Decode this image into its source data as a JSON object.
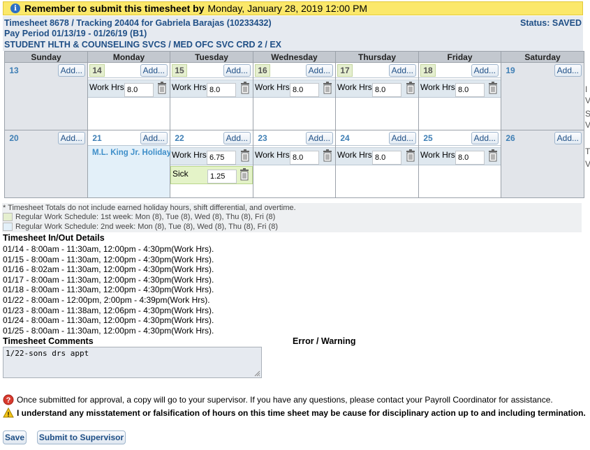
{
  "banner": {
    "bold": "Remember to submit this timesheet by",
    "date": "Monday, January 28, 2019 12:00 PM"
  },
  "header": {
    "line1": "Timesheet 8678 / Tracking 20404 for Gabriela Barajas (10233432)",
    "line2": "Pay Period 01/13/19 - 01/26/19 (B1)",
    "line3": "STUDENT HLTH & COUNSELING SVCS / MED OFC SVC CRD 2 / EX",
    "status": "Status: SAVED"
  },
  "calendar": {
    "days": [
      "Sunday",
      "Monday",
      "Tuesday",
      "Wednesday",
      "Thursday",
      "Friday",
      "Saturday"
    ],
    "add_label": "Add...",
    "week1": [
      {
        "num": "13",
        "type": "weekend",
        "entries": []
      },
      {
        "num": "14",
        "type": "w1",
        "entries": [
          {
            "label": "Work Hrs",
            "value": "8.0"
          }
        ]
      },
      {
        "num": "15",
        "type": "w1",
        "entries": [
          {
            "label": "Work Hrs",
            "value": "8.0"
          }
        ]
      },
      {
        "num": "16",
        "type": "w1",
        "entries": [
          {
            "label": "Work Hrs",
            "value": "8.0"
          }
        ]
      },
      {
        "num": "17",
        "type": "w1",
        "entries": [
          {
            "label": "Work Hrs",
            "value": "8.0"
          }
        ]
      },
      {
        "num": "18",
        "type": "w1",
        "entries": [
          {
            "label": "Work Hrs",
            "value": "8.0"
          }
        ]
      },
      {
        "num": "19",
        "type": "weekend",
        "entries": []
      }
    ],
    "week2": [
      {
        "num": "20",
        "type": "weekend",
        "entries": []
      },
      {
        "num": "21",
        "type": "holiday",
        "holiday": "M.L. King Jr. Holiday",
        "entries": []
      },
      {
        "num": "22",
        "type": "w2",
        "entries": [
          {
            "label": "Work Hrs",
            "value": "6.75"
          },
          {
            "label": "Sick",
            "value": "1.25",
            "kind": "sick"
          }
        ]
      },
      {
        "num": "23",
        "type": "w2",
        "entries": [
          {
            "label": "Work Hrs",
            "value": "8.0"
          }
        ]
      },
      {
        "num": "24",
        "type": "w2",
        "entries": [
          {
            "label": "Work Hrs",
            "value": "8.0"
          }
        ]
      },
      {
        "num": "25",
        "type": "w2",
        "entries": [
          {
            "label": "Work Hrs",
            "value": "8.0"
          }
        ]
      },
      {
        "num": "26",
        "type": "weekend",
        "entries": []
      }
    ]
  },
  "legend": {
    "note": "* Timesheet Totals do not include earned holiday hours, shift differential, and overtime.",
    "week1": "Regular Work Schedule: 1st week: Mon (8), Tue (8), Wed (8), Thu (8), Fri (8)",
    "week2": "Regular Work Schedule: 2nd week: Mon (8), Tue (8), Wed (8), Thu (8), Fri (8)",
    "week1_color": "#e5efcf",
    "week2_color": "#e3f0f9"
  },
  "inout": {
    "title": "Timesheet In/Out Details",
    "lines": [
      "01/14 - 8:00am - 11:30am, 12:00pm - 4:30pm(Work Hrs).",
      "01/15 - 8:00am - 11:30am, 12:00pm - 4:30pm(Work Hrs).",
      "01/16 - 8:02am - 11:30am, 12:00pm - 4:30pm(Work Hrs).",
      "01/17 - 8:00am - 11:30am, 12:00pm - 4:30pm(Work Hrs).",
      "01/18 - 8:00am - 11:30am, 12:00pm - 4:30pm(Work Hrs).",
      "01/22 - 8:00am - 12:00pm, 2:00pm - 4:39pm(Work Hrs).",
      "01/23 - 8:00am - 11:38am, 12:06pm - 4:30pm(Work Hrs).",
      "01/24 - 8:00am - 11:30am, 12:00pm - 4:30pm(Work Hrs).",
      "01/25 - 8:00am - 11:30am, 12:00pm - 4:30pm(Work Hrs)."
    ]
  },
  "comments": {
    "title": "Timesheet Comments",
    "value": "1/22-sons drs appt"
  },
  "error_title": "Error / Warning",
  "notes": {
    "approval": "Once submitted for approval, a copy will go to your supervisor. If you have any questions, please contact your Payroll Coordinator for assistance.",
    "warning": "I understand any misstatement or falsification of hours on this time sheet may be cause for disciplinary action up to and including termination."
  },
  "buttons": {
    "save": "Save",
    "submit": "Submit to Supervisor"
  },
  "clipped": {
    "r1": "I",
    "r2": "V",
    "r3": "S",
    "r4": "V",
    "r5": "T",
    "r6": "V"
  }
}
